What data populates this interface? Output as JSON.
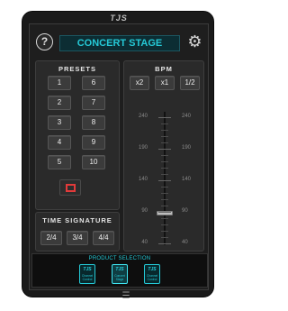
{
  "device": {
    "brand": "TJS"
  },
  "header": {
    "help_icon": "question-circle-icon",
    "help_label": "?",
    "title": "CONCERT STAGE",
    "settings_icon": "gear-icon",
    "settings_glyph": "⚙"
  },
  "presets": {
    "title": "PRESETS",
    "buttons": [
      "1",
      "6",
      "2",
      "7",
      "3",
      "8",
      "4",
      "9",
      "5",
      "10"
    ],
    "stop_icon": "stop-square-icon",
    "stop_color": "#e23a3a"
  },
  "time_signature": {
    "title": "TIME SIGNATURE",
    "options": [
      "2/4",
      "3/4",
      "4/4"
    ]
  },
  "bpm": {
    "title": "BPM",
    "multipliers": [
      "x2",
      "x1",
      "1/2"
    ],
    "scale_labels": [
      "240",
      "190",
      "140",
      "90",
      "40"
    ],
    "scale_min": 40,
    "scale_max": 240,
    "value": 88
  },
  "product_selection": {
    "title": "PRODUCT SELECTION",
    "items": [
      {
        "logo": "TJS",
        "label": "Channel Control"
      },
      {
        "logo": "TJS",
        "label": "Concert Stage"
      },
      {
        "logo": "TJS",
        "label": "Channel Control"
      }
    ],
    "active_index": 1
  },
  "home": {
    "icon": "menu-lines-icon",
    "glyph": "☰"
  },
  "colors": {
    "accent": "#25c9d6",
    "background": "#1e1e1e"
  }
}
